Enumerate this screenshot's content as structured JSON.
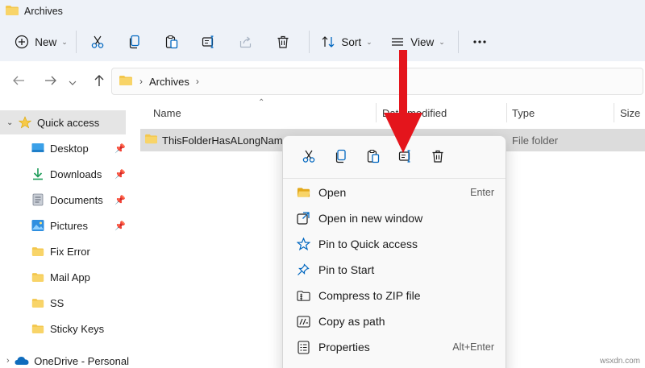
{
  "window": {
    "title": "Archives"
  },
  "toolbar": {
    "new_label": "New",
    "sort_label": "Sort",
    "view_label": "View"
  },
  "address": {
    "crumb": "Archives"
  },
  "sidebar": {
    "items": [
      {
        "label": "Quick access",
        "icon": "star-icon"
      },
      {
        "label": "Desktop",
        "icon": "desktop-icon"
      },
      {
        "label": "Downloads",
        "icon": "download-icon"
      },
      {
        "label": "Documents",
        "icon": "document-icon"
      },
      {
        "label": "Pictures",
        "icon": "pictures-icon"
      },
      {
        "label": "Fix Error",
        "icon": "folder-icon"
      },
      {
        "label": "Mail App",
        "icon": "folder-icon"
      },
      {
        "label": "SS",
        "icon": "folder-icon"
      },
      {
        "label": "Sticky Keys",
        "icon": "folder-icon"
      },
      {
        "label": "OneDrive - Personal",
        "icon": "cloud-icon"
      }
    ]
  },
  "columns": {
    "name": "Name",
    "date": "Date modified",
    "type": "Type",
    "size": "Size"
  },
  "files": [
    {
      "name": "ThisFolderHasALongName",
      "type": "File folder"
    }
  ],
  "context_menu": {
    "items": [
      {
        "label": "Open",
        "shortcut": "Enter",
        "icon": "folder-open-icon"
      },
      {
        "label": "Open in new window",
        "shortcut": "",
        "icon": "open-new-window-icon"
      },
      {
        "label": "Pin to Quick access",
        "shortcut": "",
        "icon": "star-outline-icon"
      },
      {
        "label": "Pin to Start",
        "shortcut": "",
        "icon": "pin-icon"
      },
      {
        "label": "Compress to ZIP file",
        "shortcut": "",
        "icon": "zip-icon"
      },
      {
        "label": "Copy as path",
        "shortcut": "",
        "icon": "copy-path-icon"
      },
      {
        "label": "Properties",
        "shortcut": "Alt+Enter",
        "icon": "properties-icon"
      }
    ]
  },
  "watermark": "wsxdn.com",
  "colors": {
    "accent": "#0067c0",
    "folder": "#f3c74d",
    "arrow": "#e4151c",
    "selection": "#dcdcdc"
  }
}
